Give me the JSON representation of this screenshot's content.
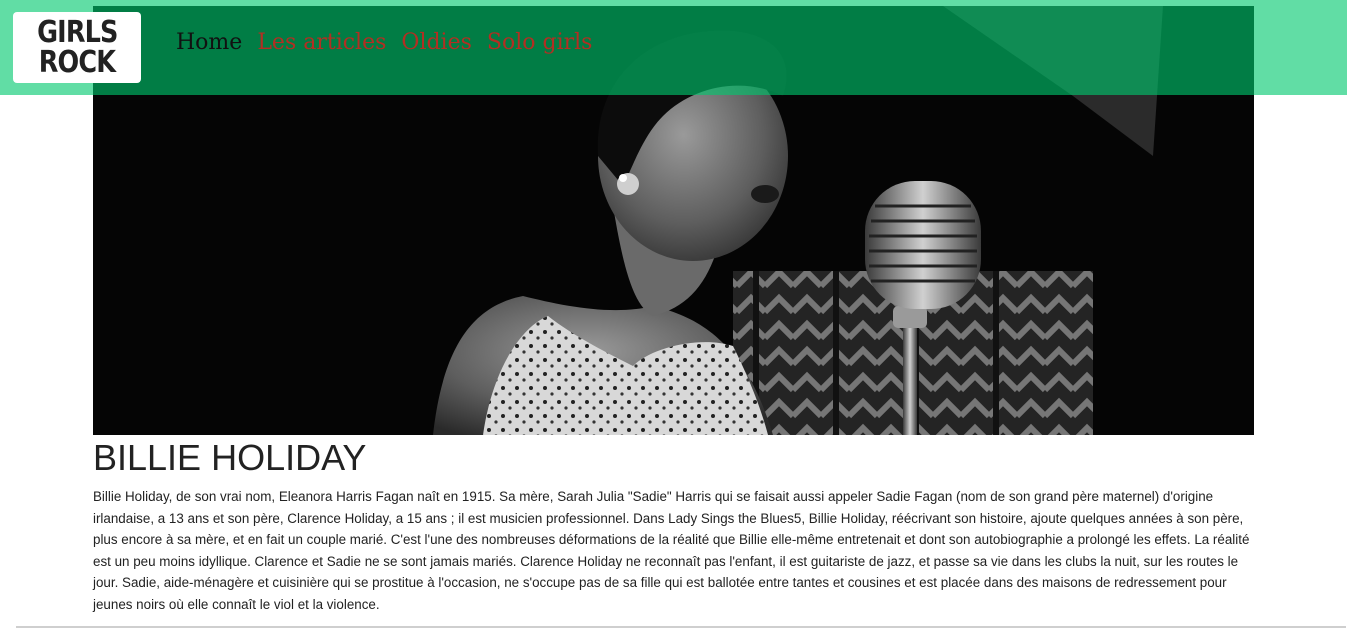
{
  "logo": {
    "line1": "GIRLS",
    "line2": "ROCK"
  },
  "nav": {
    "items": [
      {
        "label": "Home",
        "active": true
      },
      {
        "label": "Les articles",
        "active": false
      },
      {
        "label": "Oldies",
        "active": false
      },
      {
        "label": "Solo girls",
        "active": false
      }
    ]
  },
  "colors": {
    "navbar": "#00c86e",
    "nav_link": "#b22f22",
    "nav_active": "#111111"
  },
  "article": {
    "title": "BILLIE HOLIDAY",
    "body": "Billie Holiday, de son vrai nom, Eleanora Harris Fagan naît en 1915. Sa mère, Sarah Julia \"Sadie\" Harris qui se faisait aussi appeler Sadie Fagan (nom de son grand père maternel) d'origine irlandaise, a 13 ans et son père, Clarence Holiday, a 15 ans ; il est musicien professionnel. Dans Lady Sings the Blues5, Billie Holiday, réécrivant son histoire, ajoute quelques années à son père, plus encore à sa mère, et en fait un couple marié. C'est l'une des nombreuses déformations de la réalité que Billie elle-même entretenait et dont son autobiographie a prolongé les effets. La réalité est un peu moins idyllique. Clarence et Sadie ne se sont jamais mariés. Clarence Holiday ne reconnaît pas l'enfant, il est guitariste de jazz, et passe sa vie dans les clubs la nuit, sur les routes le jour. Sadie, aide-ménagère et cuisinière qui se prostitue à l'occasion, ne s'occupe pas de sa fille qui est ballotée entre tantes et cousines et est placée dans des maisons de redressement pour jeunes noirs où elle connaît le viol et la violence."
  }
}
